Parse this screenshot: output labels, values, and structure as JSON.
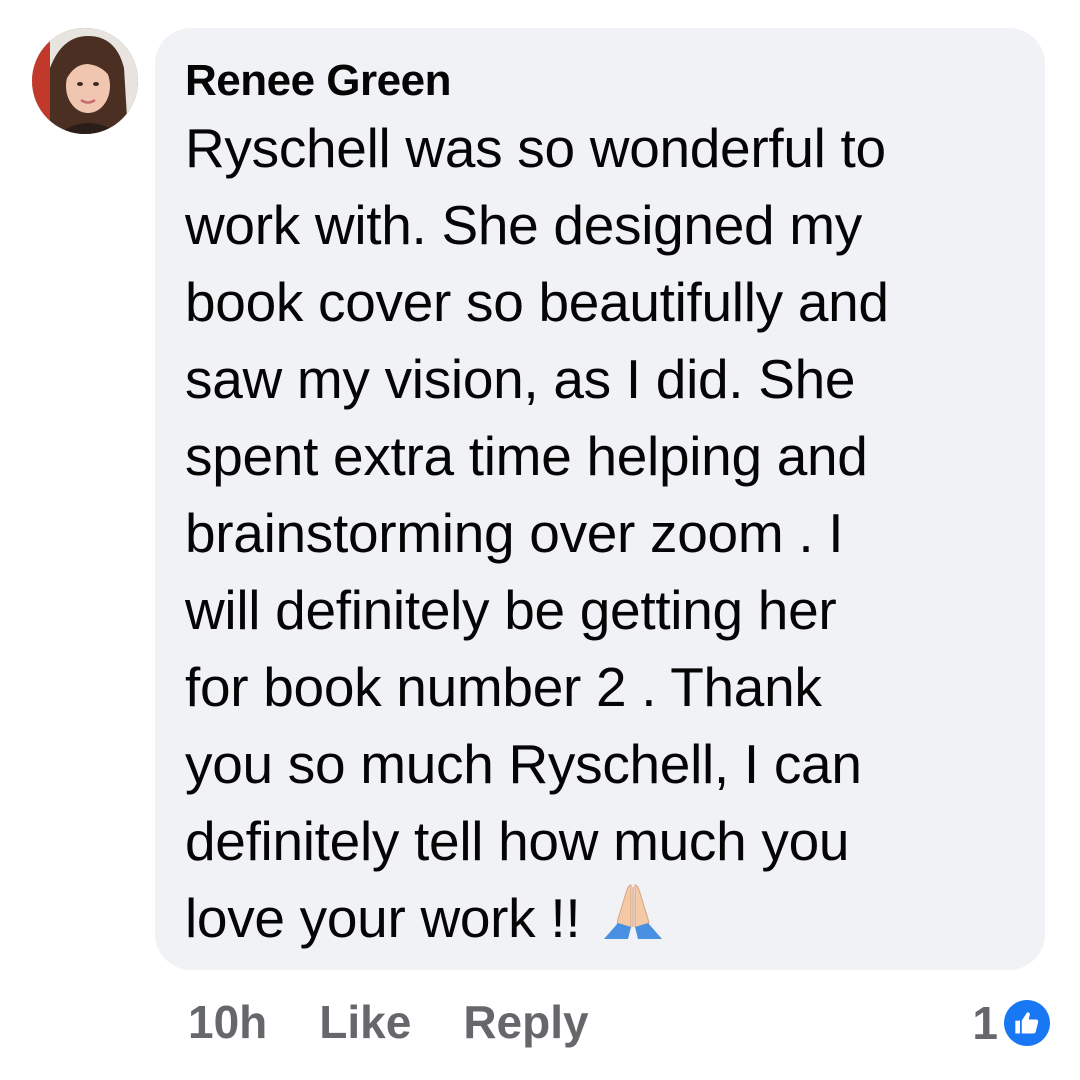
{
  "comment": {
    "author": "Renee Green",
    "text_lines": [
      "Ryschell was so wonderful to",
      "work with. She designed my",
      "book cover so beautifully and",
      "saw my vision, as I did. She",
      "spent extra time helping and",
      "brainstorming over zoom . I",
      "will definitely be getting her",
      "for book number 2 . Thank",
      "you so much Ryschell, I can",
      "definitely tell how much you",
      "love your work !!"
    ],
    "emoji": "folded-hands-icon"
  },
  "actions": {
    "time": "10h",
    "like_label": "Like",
    "reply_label": "Reply"
  },
  "reactions": {
    "count": "1",
    "icon": "thumbs-up-icon",
    "color": "#1877f2"
  },
  "colors": {
    "bubble_bg": "#f0f2f5",
    "text": "#050505",
    "meta": "#65676b"
  }
}
